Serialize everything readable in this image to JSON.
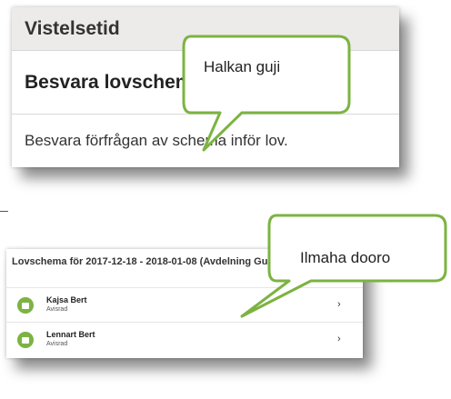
{
  "top_card": {
    "header": "Vistelsetid",
    "subtitle": "Besvara lovschema",
    "description": "Besvara förfrågan av schema inför lov."
  },
  "callouts": {
    "first": "Halkan guji",
    "second": "Ilmaha dooro"
  },
  "bottom_card": {
    "title": "Lovschema för 2017-12-18 - 2018-01-08 (Avdelning Gul)",
    "rows": [
      {
        "name": "Kajsa Bert",
        "status": "Avisrad"
      },
      {
        "name": "Lennart Bert",
        "status": "Avisrad"
      }
    ]
  },
  "colors": {
    "callout_border": "#7cb342",
    "row_icon": "#7cb342"
  },
  "icons": {
    "row_icon": "message-icon",
    "row_chevron": "chevron-right-icon"
  }
}
